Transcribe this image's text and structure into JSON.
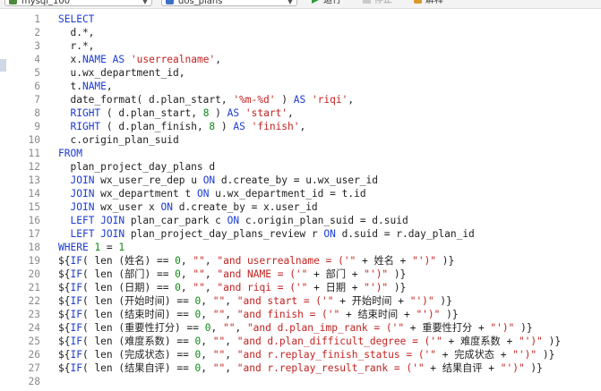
{
  "toolbar": {
    "database_select": "mysql_100",
    "table_select": "dos_plans",
    "run_label": "运行",
    "stop_label": "停止",
    "explain_label": "解释"
  },
  "editor": {
    "line_numbers": [
      "1",
      "2",
      "3",
      "4",
      "5",
      "6",
      "7",
      "8",
      "9",
      "10",
      "11",
      "12",
      "13",
      "14",
      "15",
      "16",
      "17",
      "18",
      "19",
      "20",
      "21",
      "22",
      "23",
      "24",
      "25",
      "26",
      "27",
      "28"
    ],
    "lines": [
      [
        [
          "k",
          "SELECT"
        ]
      ],
      [
        [
          "t",
          "  d.*,"
        ]
      ],
      [
        [
          "t",
          "  r.*,"
        ]
      ],
      [
        [
          "t",
          "  x."
        ],
        [
          "k",
          "NAME"
        ],
        [
          "t",
          " "
        ],
        [
          "k",
          "AS"
        ],
        [
          "t",
          " "
        ],
        [
          "s",
          "'userrealname'"
        ],
        [
          "t",
          ","
        ]
      ],
      [
        [
          "t",
          "  u.wx_department_id,"
        ]
      ],
      [
        [
          "t",
          "  t."
        ],
        [
          "k",
          "NAME"
        ],
        [
          "t",
          ","
        ]
      ],
      [
        [
          "t",
          "  date_format( d.plan_start, "
        ],
        [
          "s",
          "'%m-%d'"
        ],
        [
          "t",
          " ) "
        ],
        [
          "k",
          "AS"
        ],
        [
          "t",
          " "
        ],
        [
          "s",
          "'riqi'"
        ],
        [
          "t",
          ","
        ]
      ],
      [
        [
          "t",
          "  "
        ],
        [
          "k",
          "RIGHT"
        ],
        [
          "t",
          " ( d.plan_start, "
        ],
        [
          "n",
          "8"
        ],
        [
          "t",
          " ) "
        ],
        [
          "k",
          "AS"
        ],
        [
          "t",
          " "
        ],
        [
          "s",
          "'start'"
        ],
        [
          "t",
          ","
        ]
      ],
      [
        [
          "t",
          "  "
        ],
        [
          "k",
          "RIGHT"
        ],
        [
          "t",
          " ( d.plan_finish, "
        ],
        [
          "n",
          "8"
        ],
        [
          "t",
          " ) "
        ],
        [
          "k",
          "AS"
        ],
        [
          "t",
          " "
        ],
        [
          "s",
          "'finish'"
        ],
        [
          "t",
          ","
        ]
      ],
      [
        [
          "t",
          "  c.origin_plan_suid"
        ]
      ],
      [
        [
          "k",
          "FROM"
        ]
      ],
      [
        [
          "t",
          "  plan_project_day_plans d"
        ]
      ],
      [
        [
          "t",
          "  "
        ],
        [
          "k",
          "JOIN"
        ],
        [
          "t",
          " wx_user_re_dep u "
        ],
        [
          "k",
          "ON"
        ],
        [
          "t",
          " d.create_by = u.wx_user_id"
        ]
      ],
      [
        [
          "t",
          "  "
        ],
        [
          "k",
          "JOIN"
        ],
        [
          "t",
          " wx_department t "
        ],
        [
          "k",
          "ON"
        ],
        [
          "t",
          " u.wx_department_id = t.id"
        ]
      ],
      [
        [
          "t",
          "  "
        ],
        [
          "k",
          "JOIN"
        ],
        [
          "t",
          " wx_user x "
        ],
        [
          "k",
          "ON"
        ],
        [
          "t",
          " d.create_by = x.user_id"
        ]
      ],
      [
        [
          "t",
          "  "
        ],
        [
          "k",
          "LEFT JOIN"
        ],
        [
          "t",
          " plan_car_park c "
        ],
        [
          "k",
          "ON"
        ],
        [
          "t",
          " c.origin_plan_suid = d.suid"
        ]
      ],
      [
        [
          "t",
          "  "
        ],
        [
          "k",
          "LEFT JOIN"
        ],
        [
          "t",
          " plan_project_day_plans_review r "
        ],
        [
          "k",
          "ON"
        ],
        [
          "t",
          " d.suid = r.day_plan_id"
        ]
      ],
      [
        [
          "k",
          "WHERE"
        ],
        [
          "t",
          " "
        ],
        [
          "n",
          "1"
        ],
        [
          "t",
          " = "
        ],
        [
          "n",
          "1"
        ]
      ],
      [
        [
          "t",
          "${"
        ],
        [
          "k",
          "IF"
        ],
        [
          "t",
          "( len (姓名) == "
        ],
        [
          "n",
          "0"
        ],
        [
          "t",
          ", "
        ],
        [
          "s",
          "\"\""
        ],
        [
          "t",
          ", "
        ],
        [
          "s",
          "\"and userrealname = ('\""
        ],
        [
          "t",
          " + 姓名 + "
        ],
        [
          "s",
          "\"')\""
        ],
        [
          "t",
          " )}"
        ]
      ],
      [
        [
          "t",
          "${"
        ],
        [
          "k",
          "IF"
        ],
        [
          "t",
          "( len (部门) == "
        ],
        [
          "n",
          "0"
        ],
        [
          "t",
          ", "
        ],
        [
          "s",
          "\"\""
        ],
        [
          "t",
          ", "
        ],
        [
          "s",
          "\"and NAME = ('\""
        ],
        [
          "t",
          " + 部门 + "
        ],
        [
          "s",
          "\"')\""
        ],
        [
          "t",
          " )}"
        ]
      ],
      [
        [
          "t",
          "${"
        ],
        [
          "k",
          "IF"
        ],
        [
          "t",
          "( len (日期) == "
        ],
        [
          "n",
          "0"
        ],
        [
          "t",
          ", "
        ],
        [
          "s",
          "\"\""
        ],
        [
          "t",
          ", "
        ],
        [
          "s",
          "\"and riqi = ('\""
        ],
        [
          "t",
          " + 日期 + "
        ],
        [
          "s",
          "\"')\""
        ],
        [
          "t",
          " )}"
        ]
      ],
      [
        [
          "t",
          "${"
        ],
        [
          "k",
          "IF"
        ],
        [
          "t",
          "( len (开始时间) == "
        ],
        [
          "n",
          "0"
        ],
        [
          "t",
          ", "
        ],
        [
          "s",
          "\"\""
        ],
        [
          "t",
          ", "
        ],
        [
          "s",
          "\"and start = ('\""
        ],
        [
          "t",
          " + 开始时间 + "
        ],
        [
          "s",
          "\"')\""
        ],
        [
          "t",
          " )}"
        ]
      ],
      [
        [
          "t",
          "${"
        ],
        [
          "k",
          "IF"
        ],
        [
          "t",
          "( len (结束时间) == "
        ],
        [
          "n",
          "0"
        ],
        [
          "t",
          ", "
        ],
        [
          "s",
          "\"\""
        ],
        [
          "t",
          ", "
        ],
        [
          "s",
          "\"and finish = ('\""
        ],
        [
          "t",
          " + 结束时间 + "
        ],
        [
          "s",
          "\"')\""
        ],
        [
          "t",
          " )}"
        ]
      ],
      [
        [
          "t",
          "${"
        ],
        [
          "k",
          "IF"
        ],
        [
          "t",
          "( len (重要性打分) == "
        ],
        [
          "n",
          "0"
        ],
        [
          "t",
          ", "
        ],
        [
          "s",
          "\"\""
        ],
        [
          "t",
          ", "
        ],
        [
          "s",
          "\"and d.plan_imp_rank = ('\""
        ],
        [
          "t",
          " + 重要性打分 + "
        ],
        [
          "s",
          "\"')\""
        ],
        [
          "t",
          " )}"
        ]
      ],
      [
        [
          "t",
          "${"
        ],
        [
          "k",
          "IF"
        ],
        [
          "t",
          "( len (难度系数) == "
        ],
        [
          "n",
          "0"
        ],
        [
          "t",
          ", "
        ],
        [
          "s",
          "\"\""
        ],
        [
          "t",
          ", "
        ],
        [
          "s",
          "\"and d.plan_difficult_degree = ('\""
        ],
        [
          "t",
          " + 难度系数 + "
        ],
        [
          "s",
          "\"')\""
        ],
        [
          "t",
          " )}"
        ]
      ],
      [
        [
          "t",
          "${"
        ],
        [
          "k",
          "IF"
        ],
        [
          "t",
          "( len (完成状态) == "
        ],
        [
          "n",
          "0"
        ],
        [
          "t",
          ", "
        ],
        [
          "s",
          "\"\""
        ],
        [
          "t",
          ", "
        ],
        [
          "s",
          "\"and r.replay_finish_status = ('\""
        ],
        [
          "t",
          " + 完成状态 + "
        ],
        [
          "s",
          "\"')\""
        ],
        [
          "t",
          " )}"
        ]
      ],
      [
        [
          "t",
          "${"
        ],
        [
          "k",
          "IF"
        ],
        [
          "t",
          "( len (结果自评) == "
        ],
        [
          "n",
          "0"
        ],
        [
          "t",
          ", "
        ],
        [
          "s",
          "\"\""
        ],
        [
          "t",
          ", "
        ],
        [
          "s",
          "\"and r.replay_result_rank = ('\""
        ],
        [
          "t",
          " + 结果自评 + "
        ],
        [
          "s",
          "\"')\""
        ],
        [
          "t",
          " )}"
        ]
      ],
      [
        [
          "t",
          ""
        ]
      ]
    ]
  }
}
